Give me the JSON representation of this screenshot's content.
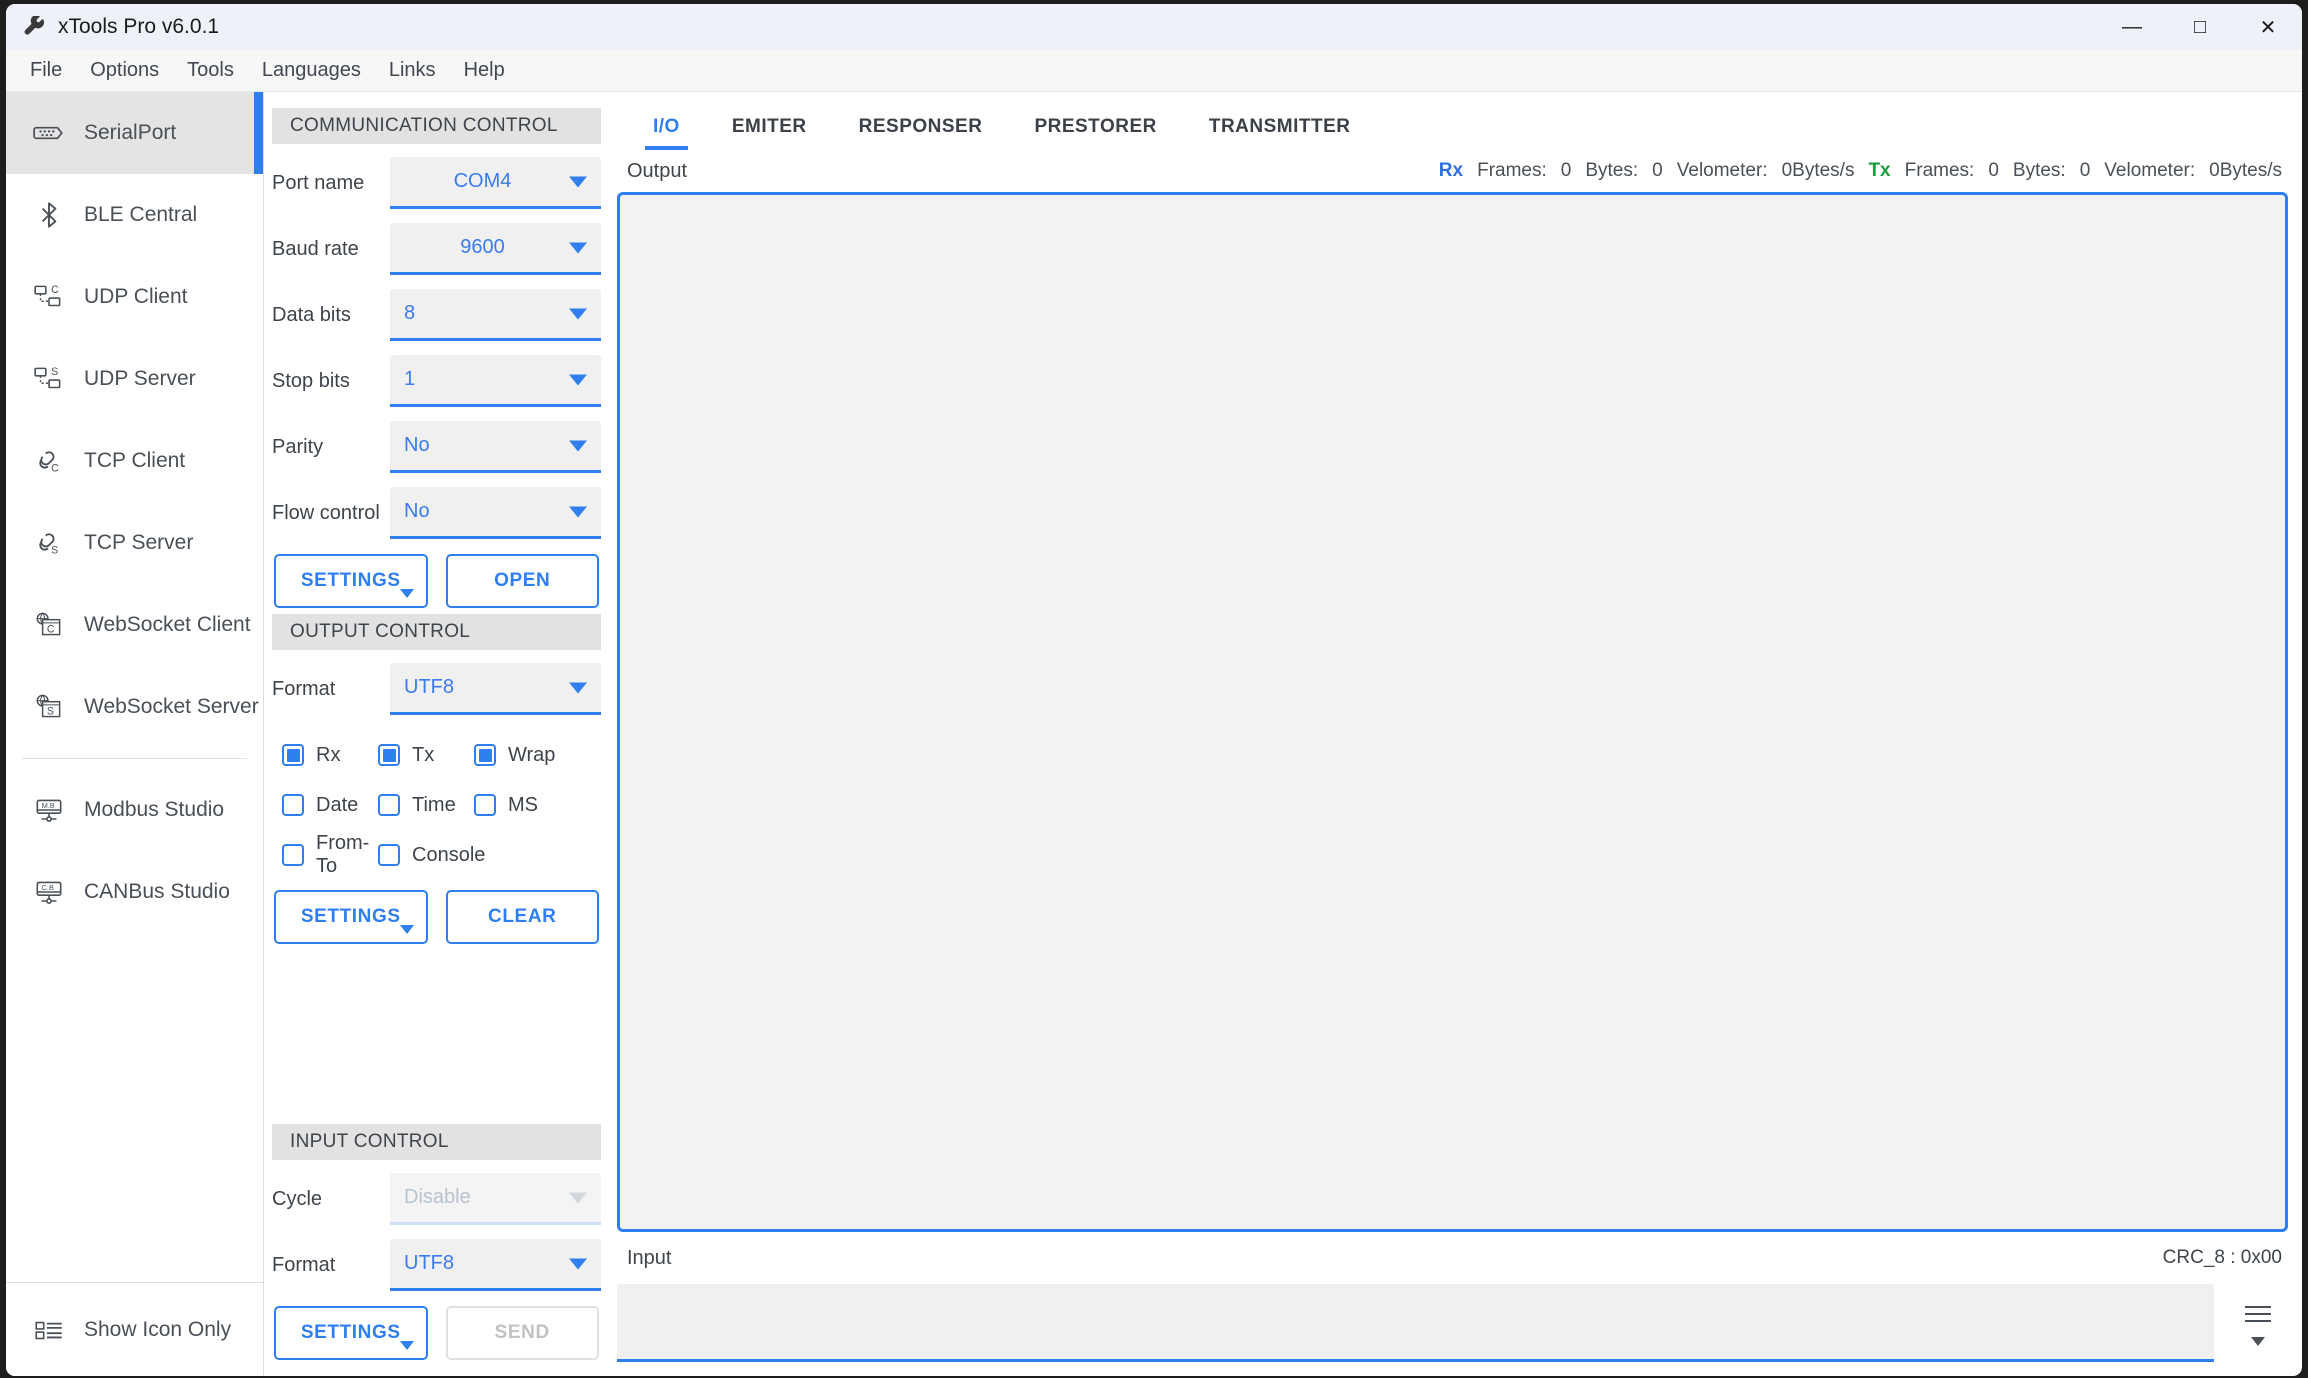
{
  "window": {
    "title": "xTools Pro v6.0.1",
    "app_icon": "wrench-icon",
    "minimize": "—",
    "maximize": "□",
    "close": "✕"
  },
  "menubar": {
    "items": [
      {
        "label": "File"
      },
      {
        "label": "Options"
      },
      {
        "label": "Tools"
      },
      {
        "label": "Languages"
      },
      {
        "label": "Links"
      },
      {
        "label": "Help"
      }
    ]
  },
  "sidebar": {
    "items": [
      {
        "label": "SerialPort",
        "icon": "serial-port-icon",
        "active": true
      },
      {
        "label": "BLE Central",
        "icon": "bluetooth-icon",
        "active": false
      },
      {
        "label": "UDP Client",
        "icon": "udp-client-icon",
        "active": false
      },
      {
        "label": "UDP Server",
        "icon": "udp-server-icon",
        "active": false
      },
      {
        "label": "TCP Client",
        "icon": "tcp-client-icon",
        "active": false
      },
      {
        "label": "TCP Server",
        "icon": "tcp-server-icon",
        "active": false
      },
      {
        "label": "WebSocket Client",
        "icon": "websocket-client-icon",
        "active": false
      },
      {
        "label": "WebSocket Server",
        "icon": "websocket-server-icon",
        "active": false
      },
      {
        "label": "Modbus Studio",
        "icon": "modbus-studio-icon",
        "active": false
      },
      {
        "label": "CANBus Studio",
        "icon": "canbus-studio-icon",
        "active": false
      }
    ],
    "footer": {
      "label": "Show Icon Only",
      "icon": "list-view-icon"
    }
  },
  "communication_control": {
    "title": "COMMUNICATION CONTROL",
    "fields": [
      {
        "label": "Port name",
        "value": "COM4",
        "align": "center",
        "enabled": true
      },
      {
        "label": "Baud rate",
        "value": "9600",
        "align": "center",
        "enabled": true
      },
      {
        "label": "Data bits",
        "value": "8",
        "align": "left",
        "enabled": true
      },
      {
        "label": "Stop bits",
        "value": "1",
        "align": "left",
        "enabled": true
      },
      {
        "label": "Parity",
        "value": "No",
        "align": "left",
        "enabled": true
      },
      {
        "label": "Flow control",
        "value": "No",
        "align": "left",
        "enabled": true
      }
    ],
    "settings_label": "SETTINGS",
    "open_label": "OPEN"
  },
  "output_control": {
    "title": "OUTPUT CONTROL",
    "format_label": "Format",
    "format_value": "UTF8",
    "checkboxes": [
      {
        "label": "Rx",
        "checked": true
      },
      {
        "label": "Tx",
        "checked": true
      },
      {
        "label": "Wrap",
        "checked": true
      },
      {
        "label": "Date",
        "checked": false
      },
      {
        "label": "Time",
        "checked": false
      },
      {
        "label": "MS",
        "checked": false
      },
      {
        "label": "From-To",
        "checked": false
      },
      {
        "label": "Console",
        "checked": false
      }
    ],
    "settings_label": "SETTINGS",
    "clear_label": "CLEAR"
  },
  "input_control": {
    "title": "INPUT CONTROL",
    "cycle_label": "Cycle",
    "cycle_value": "Disable",
    "cycle_enabled": false,
    "format_label": "Format",
    "format_value": "UTF8",
    "settings_label": "SETTINGS",
    "send_label": "SEND",
    "send_enabled": false
  },
  "main": {
    "tabs": [
      {
        "label": "I/O",
        "active": true
      },
      {
        "label": "EMITER",
        "active": false
      },
      {
        "label": "RESPONSER",
        "active": false
      },
      {
        "label": "PRESTORER",
        "active": false
      },
      {
        "label": "TRANSMITTER",
        "active": false
      }
    ],
    "output_label": "Output",
    "output_text": "",
    "stats": {
      "rx_tag": "Rx",
      "rx_frames_label": "Frames:",
      "rx_frames": "0",
      "rx_bytes_label": "Bytes:",
      "rx_bytes": "0",
      "rx_velometer_label": "Velometer:",
      "rx_velometer": "0Bytes/s",
      "tx_tag": "Tx",
      "tx_frames_label": "Frames:",
      "tx_frames": "0",
      "tx_bytes_label": "Bytes:",
      "tx_bytes": "0",
      "tx_velometer_label": "Velometer:",
      "tx_velometer": "0Bytes/s"
    },
    "input_label": "Input",
    "crc_label": "CRC_8 : 0x00",
    "input_value": "",
    "menu_icon": "hamburger-menu-icon"
  },
  "colors": {
    "accent": "#2f7ff0",
    "rx": "#2f6fe0",
    "tx": "#1a9d3f",
    "panel_head": "#e2e2e2",
    "field_bg": "#f0f0f0"
  }
}
